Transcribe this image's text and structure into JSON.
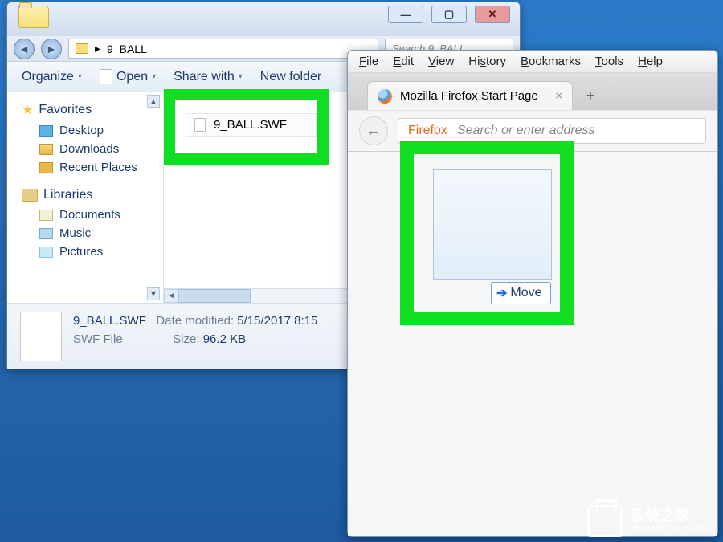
{
  "explorer": {
    "titlebar": {
      "min": "—",
      "max": "▢",
      "close": "✕"
    },
    "address": {
      "path_chevron": "▸",
      "folder_name": "9_BALL"
    },
    "search": {
      "placeholder": "Search 9_BALL"
    },
    "toolbar": {
      "organize": "Organize",
      "open": "Open",
      "share": "Share with",
      "newfolder": "New folder"
    },
    "nav": {
      "favorites": "Favorites",
      "desktop": "Desktop",
      "downloads": "Downloads",
      "recent": "Recent Places",
      "libraries": "Libraries",
      "documents": "Documents",
      "music": "Music",
      "pictures": "Pictures"
    },
    "file": {
      "name": "9_BALL.SWF"
    },
    "status": {
      "filename": "9_BALL.SWF",
      "filetype": "SWF File",
      "modified_label": "Date modified:",
      "modified_value": "5/15/2017 8:15",
      "size_label": "Size:",
      "size_value": "96.2 KB"
    }
  },
  "firefox": {
    "menubar": {
      "file": "File",
      "edit": "Edit",
      "view": "View",
      "history": "History",
      "bookmarks": "Bookmarks",
      "tools": "Tools",
      "help": "Help"
    },
    "tab": {
      "title": "Mozilla Firefox Start Page",
      "close": "×",
      "new": "+"
    },
    "url": {
      "brand": "Firefox",
      "placeholder": "Search or enter address"
    },
    "drag": {
      "move_label": "Move"
    }
  },
  "watermark": {
    "line1": "系统之家",
    "line2": "XITONGZHIJIA.NET"
  }
}
